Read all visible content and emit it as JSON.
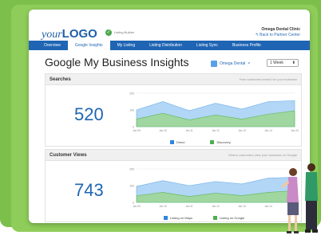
{
  "header": {
    "logo_light": "your",
    "logo_bold": "LOGO",
    "builder_label": "Listing Builder",
    "clinic_name": "Omega Dental Clinic",
    "back_link": "Back to Partner Center"
  },
  "nav": {
    "items": [
      "Overview",
      "Google Insights",
      "My Listing",
      "Listing Distribution",
      "Listing Sync",
      "Business Profile"
    ],
    "active_index": 1
  },
  "page": {
    "title": "Google My Business Insights",
    "account": "Omega Dental",
    "account_close": "×",
    "range": "1 Week",
    "range_caret": "⬍"
  },
  "colors": {
    "brand_blue": "#1f65b4",
    "background_green": "#7cc04b",
    "series_blue": "#aad1f5",
    "series_green": "#9fd69a"
  },
  "searches": {
    "title": "Searches",
    "subtitle": "How customers search for your business",
    "total": "520",
    "legend": [
      {
        "label": "Direct",
        "color": "#2e86de"
      },
      {
        "label": "Discovery",
        "color": "#4caf50"
      }
    ]
  },
  "views": {
    "title": "Customer Views",
    "subtitle": "Where customers view your business on Google",
    "total": "743",
    "legend": [
      {
        "label": "Listing on Maps",
        "color": "#2e86de"
      },
      {
        "label": "Listing on Google",
        "color": "#4caf50"
      }
    ]
  },
  "chart_data": [
    {
      "type": "area",
      "categories": [
        "Jan 09",
        "Jan 10",
        "Jan 11",
        "Jan 12",
        "Jan 13",
        "Jan 14",
        "Jan 15"
      ],
      "ylim": [
        0,
        200
      ],
      "yticks": [
        "200",
        "100",
        "0"
      ],
      "series": [
        {
          "name": "Direct",
          "values": [
            100,
            150,
            95,
            140,
            105,
            150,
            155
          ]
        },
        {
          "name": "Discovery",
          "values": [
            45,
            80,
            40,
            70,
            45,
            75,
            95
          ]
        }
      ]
    },
    {
      "type": "area",
      "categories": [
        "Jan 09",
        "Jan 10",
        "Jan 11",
        "Jan 12",
        "Jan 13",
        "Jan 14",
        "Jan 15"
      ],
      "ylim": [
        0,
        200
      ],
      "yticks": [
        "200",
        "100",
        "0"
      ],
      "series": [
        {
          "name": "Listing on Maps",
          "values": [
            95,
            130,
            100,
            125,
            110,
            145,
            150
          ]
        },
        {
          "name": "Listing on Google",
          "values": [
            40,
            60,
            35,
            55,
            40,
            60,
            70
          ]
        }
      ]
    }
  ]
}
